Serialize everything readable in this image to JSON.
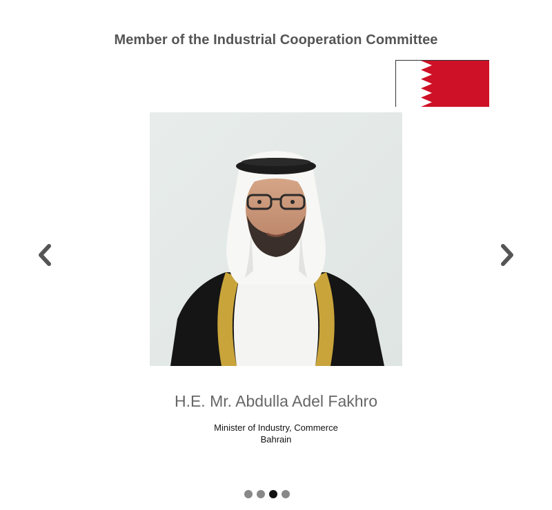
{
  "heading": "Member of the Industrial Cooperation Committee",
  "flag": {
    "country": "Bahrain",
    "icon": "bahrain-flag-icon",
    "colors": {
      "red": "#ce1126",
      "white": "#ffffff"
    }
  },
  "portrait": {
    "icon": "portrait-photo"
  },
  "navigation": {
    "prev_icon": "chevron-left-icon",
    "next_icon": "chevron-right-icon",
    "arrow_color": "#555555"
  },
  "member": {
    "name": "H.E. Mr. Abdulla Adel Fakhro",
    "title": "Minister of Industry, Commerce",
    "country": "Bahrain"
  },
  "pagination": {
    "total": 4,
    "active_index": 2
  }
}
